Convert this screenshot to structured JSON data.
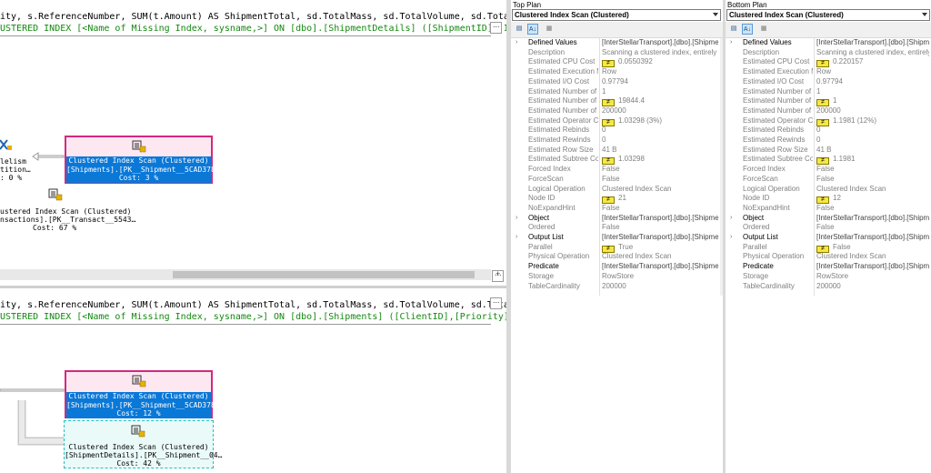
{
  "left": {
    "top": {
      "query": "ity, s.ReferenceNumber, SUM(t.Amount) AS ShipmentTotal, sd.TotalMass, sd.TotalVolume, sd.Total…",
      "missing": "USTERED INDEX [<Name of Missing Index, sysname,>] ON [dbo].[ShipmentDetails] ([ShipmentID]) IN…",
      "nodes": [
        {
          "line1": "Clustered Index Scan (Clustered)",
          "line2": "[Shipments].[PK__Shipment__5CAD378…",
          "cost": "Cost: 3 %"
        },
        {
          "line1": "lelism",
          "line2": "tition…",
          "cost": ": 0 %"
        },
        {
          "line1": "ustered Index Scan (Clustered)",
          "line2": "nsactions].[PK__Transact__5543…",
          "cost": "Cost: 67 %"
        }
      ],
      "scroll_plus": "+"
    },
    "bottom": {
      "query": "ity, s.ReferenceNumber, SUM(t.Amount) AS ShipmentTotal, sd.TotalMass, sd.TotalVolume, sd.Total…",
      "missing": "USTERED INDEX [<Name of Missing Index, sysname,>] ON [dbo].[Shipments] ([ClientID],[Priority])",
      "nodes": [
        {
          "line1": "Clustered Index Scan (Clustered)",
          "line2": "[Shipments].[PK__Shipment__5CAD378…",
          "cost": "Cost: 12 %"
        },
        {
          "line1": "Clustered Index Scan (Clustered)",
          "line2": "[ShipmentDetails].[PK__Shipment__04…",
          "cost": "Cost: 42 %"
        }
      ]
    }
  },
  "panes": [
    {
      "title": "Top Plan",
      "selected": "Clustered Index Scan (Clustered)",
      "rows": [
        {
          "name": "Defined Values",
          "value": "[InterStellarTransport].[dbo].[Shipments].S",
          "cat": true,
          "expand": "›",
          "neq": false
        },
        {
          "name": "Description",
          "value": "Scanning a clustered index, entirely or on",
          "cat": false,
          "expand": "",
          "neq": false
        },
        {
          "name": "Estimated CPU Cost",
          "value": "0.0550392",
          "cat": false,
          "expand": "",
          "neq": true
        },
        {
          "name": "Estimated Execution Mode",
          "value": "Row",
          "cat": false,
          "expand": "",
          "neq": false
        },
        {
          "name": "Estimated I/O Cost",
          "value": "0.97794",
          "cat": false,
          "expand": "",
          "neq": false
        },
        {
          "name": "Estimated Number of Executions",
          "value": "1",
          "cat": false,
          "expand": "",
          "neq": false
        },
        {
          "name": "Estimated Number of Rows",
          "value": "19844.4",
          "cat": false,
          "expand": "",
          "neq": true
        },
        {
          "name": "Estimated Number of Rows to be Read",
          "value": "200000",
          "cat": false,
          "expand": "",
          "neq": false
        },
        {
          "name": "Estimated Operator Cost",
          "value": "1.03298 (3%)",
          "cat": false,
          "expand": "",
          "neq": true
        },
        {
          "name": "Estimated Rebinds",
          "value": "0",
          "cat": false,
          "expand": "",
          "neq": false
        },
        {
          "name": "Estimated Rewinds",
          "value": "0",
          "cat": false,
          "expand": "",
          "neq": false
        },
        {
          "name": "Estimated Row Size",
          "value": "41 B",
          "cat": false,
          "expand": "",
          "neq": false
        },
        {
          "name": "Estimated Subtree Cost",
          "value": "1.03298",
          "cat": false,
          "expand": "",
          "neq": true
        },
        {
          "name": "Forced Index",
          "value": "False",
          "cat": false,
          "expand": "",
          "neq": false
        },
        {
          "name": "ForceScan",
          "value": "False",
          "cat": false,
          "expand": "",
          "neq": false
        },
        {
          "name": "Logical Operation",
          "value": "Clustered Index Scan",
          "cat": false,
          "expand": "",
          "neq": false
        },
        {
          "name": "Node ID",
          "value": "21",
          "cat": false,
          "expand": "",
          "neq": true
        },
        {
          "name": "NoExpandHint",
          "value": "False",
          "cat": false,
          "expand": "",
          "neq": false
        },
        {
          "name": "Object",
          "value": "[InterStellarTransport].[dbo].[Shipments].[",
          "cat": true,
          "expand": "›",
          "neq": false
        },
        {
          "name": "Ordered",
          "value": "False",
          "cat": false,
          "expand": "",
          "neq": false
        },
        {
          "name": "Output List",
          "value": "[InterStellarTransport].[dbo].[Shipments].S",
          "cat": true,
          "expand": "›",
          "neq": false
        },
        {
          "name": "Parallel",
          "value": "True",
          "cat": false,
          "expand": "",
          "neq": true
        },
        {
          "name": "Physical Operation",
          "value": "Clustered Index Scan",
          "cat": false,
          "expand": "",
          "neq": false
        },
        {
          "name": "Predicate",
          "value": "[InterStellarTransport].[dbo].[Shipments].[",
          "cat": true,
          "expand": "",
          "neq": false
        },
        {
          "name": "Storage",
          "value": "RowStore",
          "cat": false,
          "expand": "",
          "neq": false
        },
        {
          "name": "TableCardinality",
          "value": "200000",
          "cat": false,
          "expand": "",
          "neq": false
        }
      ]
    },
    {
      "title": "Bottom Plan",
      "selected": "Clustered Index Scan (Clustered)",
      "rows": [
        {
          "name": "Defined Values",
          "value": "[InterStellarTransport].[dbo].[Shipments].[",
          "cat": true,
          "expand": "›",
          "neq": false
        },
        {
          "name": "Description",
          "value": "Scanning a clustered index, entirely or on",
          "cat": false,
          "expand": "",
          "neq": false
        },
        {
          "name": "Estimated CPU Cost",
          "value": "0.220157",
          "cat": false,
          "expand": "",
          "neq": true
        },
        {
          "name": "Estimated Execution Mode",
          "value": "Row",
          "cat": false,
          "expand": "",
          "neq": false
        },
        {
          "name": "Estimated I/O Cost",
          "value": "0.97794",
          "cat": false,
          "expand": "",
          "neq": false
        },
        {
          "name": "Estimated Number of Executions",
          "value": "1",
          "cat": false,
          "expand": "",
          "neq": false
        },
        {
          "name": "Estimated Number of Rows",
          "value": "1",
          "cat": false,
          "expand": "",
          "neq": true
        },
        {
          "name": "Estimated Number of Rows to be Read",
          "value": "200000",
          "cat": false,
          "expand": "",
          "neq": false
        },
        {
          "name": "Estimated Operator Cost",
          "value": "1.1981 (12%)",
          "cat": false,
          "expand": "",
          "neq": true
        },
        {
          "name": "Estimated Rebinds",
          "value": "0",
          "cat": false,
          "expand": "",
          "neq": false
        },
        {
          "name": "Estimated Rewinds",
          "value": "0",
          "cat": false,
          "expand": "",
          "neq": false
        },
        {
          "name": "Estimated Row Size",
          "value": "41 B",
          "cat": false,
          "expand": "",
          "neq": false
        },
        {
          "name": "Estimated Subtree Cost",
          "value": "1.1981",
          "cat": false,
          "expand": "",
          "neq": true
        },
        {
          "name": "Forced Index",
          "value": "False",
          "cat": false,
          "expand": "",
          "neq": false
        },
        {
          "name": "ForceScan",
          "value": "False",
          "cat": false,
          "expand": "",
          "neq": false
        },
        {
          "name": "Logical Operation",
          "value": "Clustered Index Scan",
          "cat": false,
          "expand": "",
          "neq": false
        },
        {
          "name": "Node ID",
          "value": "12",
          "cat": false,
          "expand": "",
          "neq": true
        },
        {
          "name": "NoExpandHint",
          "value": "False",
          "cat": false,
          "expand": "",
          "neq": false
        },
        {
          "name": "Object",
          "value": "[InterStellarTransport].[dbo].[Shipments].[",
          "cat": true,
          "expand": "›",
          "neq": false
        },
        {
          "name": "Ordered",
          "value": "False",
          "cat": false,
          "expand": "",
          "neq": false
        },
        {
          "name": "Output List",
          "value": "[InterStellarTransport].[dbo].[Shipments].[",
          "cat": true,
          "expand": "›",
          "neq": false
        },
        {
          "name": "Parallel",
          "value": "False",
          "cat": false,
          "expand": "",
          "neq": true
        },
        {
          "name": "Physical Operation",
          "value": "Clustered Index Scan",
          "cat": false,
          "expand": "",
          "neq": false
        },
        {
          "name": "Predicate",
          "value": "[InterStellarTransport].[dbo].[Shipments].[",
          "cat": true,
          "expand": "",
          "neq": false
        },
        {
          "name": "Storage",
          "value": "RowStore",
          "cat": false,
          "expand": "",
          "neq": false
        },
        {
          "name": "TableCardinality",
          "value": "200000",
          "cat": false,
          "expand": "",
          "neq": false
        }
      ]
    }
  ],
  "toolbar": {
    "categorized_icon": "categorized-icon",
    "alphabetical_icon": "alphabetical-icon",
    "pages_icon": "property-pages-icon"
  },
  "colors": {
    "selection": "#0a78d7",
    "highlight_border": "#d4287f",
    "highlight_fill": "#fde8f2",
    "dashed_border": "#26bfbf",
    "dashed_fill": "#eafaf8",
    "missing_index_text": "#13890f",
    "neq_badge": "#f5e842"
  }
}
